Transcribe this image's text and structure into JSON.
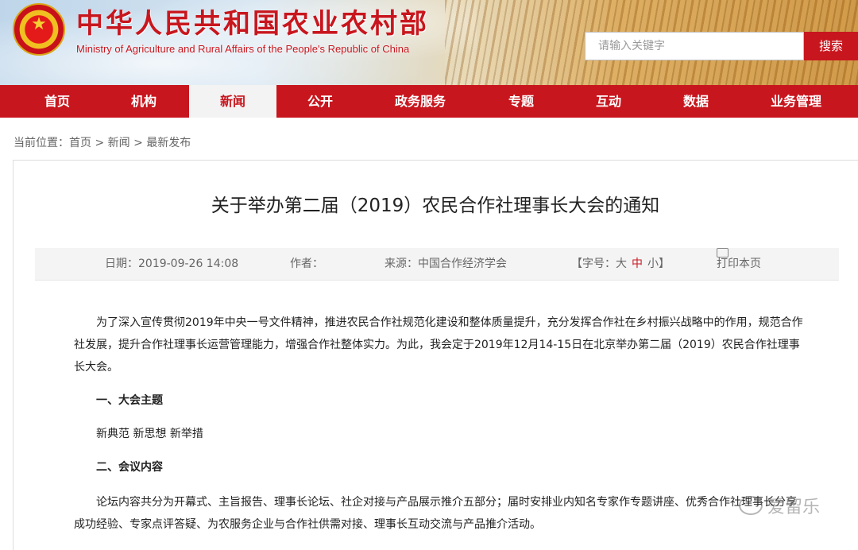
{
  "header": {
    "title_cn": "中华人民共和国农业农村部",
    "title_en": "Ministry of Agriculture and Rural Affairs of the People's Republic of China",
    "search_placeholder": "请输入关键字",
    "search_button": "搜索"
  },
  "nav": {
    "items": [
      {
        "label": "首页"
      },
      {
        "label": "机构"
      },
      {
        "label": "新闻"
      },
      {
        "label": "公开"
      },
      {
        "label": "政务服务"
      },
      {
        "label": "专题"
      },
      {
        "label": "互动"
      },
      {
        "label": "数据"
      },
      {
        "label": "业务管理"
      }
    ],
    "active_index": 2
  },
  "breadcrumb": {
    "prefix": "当前位置：",
    "items": [
      "首页",
      "新闻",
      "最新发布"
    ],
    "separator": " > "
  },
  "article": {
    "title": "关于举办第二届（2019）农民合作社理事长大会的通知",
    "meta": {
      "date": "日期：2019-09-26 14:08",
      "author": "作者：",
      "source": "来源：中国合作经济学会",
      "fontsize_open": "【字号：",
      "fontsize_large": "大",
      "fontsize_medium": "中",
      "fontsize_small": "小",
      "fontsize_close": "】",
      "print": "打印本页"
    },
    "paragraph1": "为了深入宣传贯彻2019年中央一号文件精神，推进农民合作社规范化建设和整体质量提升，充分发挥合作社在乡村振兴战略中的作用，规范合作社发展，提升合作社理事长运营管理能力，增强合作社整体实力。为此，我会定于2019年12月14-15日在北京举办第二届（2019）农民合作社理事长大会。",
    "heading1": "一、大会主题",
    "theme": "新典范 新思想 新举措",
    "heading2": "二、会议内容",
    "paragraph3": "论坛内容共分为开幕式、主旨报告、理事长论坛、社企对接与产品展示推介五部分；届时安排业内知名专家作专题讲座、优秀合作社理事长分享成功经验、专家点评答疑、为农服务企业与合作社供需对接、理事长互动交流与产品推介活动。"
  },
  "watermark": "爱留乐",
  "colors": {
    "brand_red": "#c8161e",
    "nav_active_bg": "#f3f3f3",
    "meta_bg": "#f4f4f4"
  }
}
